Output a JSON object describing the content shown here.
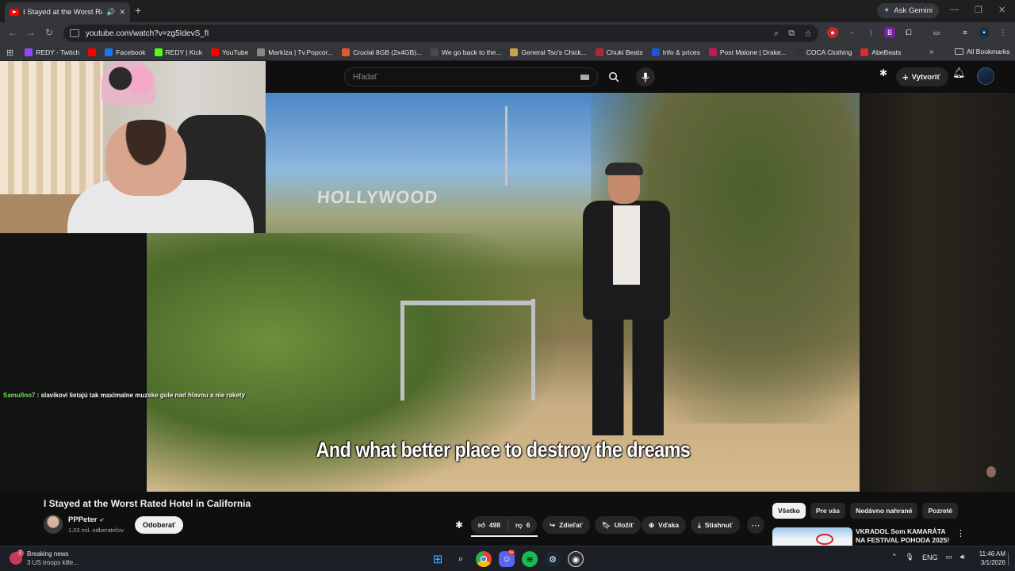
{
  "browser": {
    "tab_title": "I Stayed at the Worst Rated",
    "ask_gemini": "Ask Gemini",
    "url": "youtube.com/watch?v=zg5IdevS_fI",
    "bookmarks": [
      {
        "label": "REDY - Twitch",
        "color": "#9146ff"
      },
      {
        "label": "",
        "color": "#ff0000"
      },
      {
        "label": "Facebook",
        "color": "#1877f2"
      },
      {
        "label": "REDY | Kick",
        "color": "#53fc18"
      },
      {
        "label": "YouTube",
        "color": "#ff0000"
      },
      {
        "label": "Markíza | Tv.Popcor...",
        "color": "#888888"
      },
      {
        "label": "Crucial 8GB (2x4GB)...",
        "color": "#e4572e"
      },
      {
        "label": "We go back to the...",
        "color": "#4a4a4a"
      },
      {
        "label": "General Tso's Chick...",
        "color": "#caa24d"
      },
      {
        "label": "Chuki Beats",
        "color": "#b3263a"
      },
      {
        "label": "Info & prices",
        "color": "#1a56db"
      },
      {
        "label": "Post Malone | Drake...",
        "color": "#c2185b"
      },
      {
        "label": "COCA Clothing",
        "color": "#333333"
      },
      {
        "label": "AbeBeats",
        "color": "#d32f2f"
      }
    ],
    "all_bookmarks": "All Bookmarks"
  },
  "youtube": {
    "search_placeholder": "Hľadať",
    "create_label": "Vytvoriť",
    "chat": {
      "user": "Samullno7",
      "message": " : slavikovi lietajú tak maximalne muzske gule nad hlavou a nie rakety"
    },
    "video": {
      "sign_text": "HOLLYWOOD",
      "caption": "And what better place to destroy the dreams",
      "title": "I Stayed at the Worst Rated Hotel in California",
      "channel": "PPPeter",
      "subscribers": "1,03 mil. odberateľov",
      "subscribe": "Odoberať",
      "likes": "498",
      "dislikes": "6",
      "share": "Zdieľať",
      "save": "Uložiť",
      "thanks": "Vďaka",
      "download": "Stiahnuť"
    },
    "chips": [
      "Všetko",
      "Pre vás",
      "Nedávno nahrané",
      "Pozreté"
    ],
    "recommendation": {
      "title": "VKRADOL Som KAMARÁTA NA FESTIVAL POHODA 2025!"
    }
  },
  "taskbar": {
    "news_title": "Breaking news",
    "news_sub": "3 US troops kille...",
    "news_badge": "2",
    "discord_badge": "9+",
    "lang": "ENG",
    "time": "11:46 AM",
    "date": "3/1/2026"
  }
}
